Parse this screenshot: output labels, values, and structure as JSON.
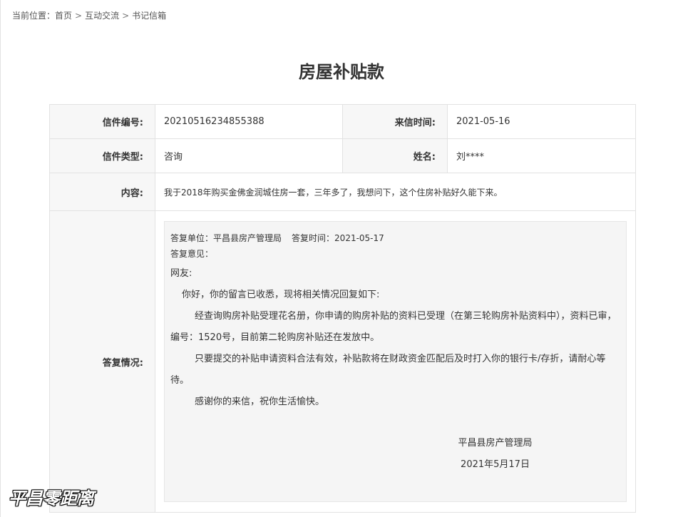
{
  "breadcrumb": {
    "prefix": "当前位置：",
    "items": [
      "首页",
      "互动交流",
      "书记信箱"
    ],
    "separator": ">"
  },
  "page_title": "房屋补贴款",
  "letter": {
    "number_label": "信件编号:",
    "number": "20210516234855388",
    "time_label": "来信时间:",
    "time": "2021-05-16",
    "type_label": "信件类型:",
    "type": "咨询",
    "name_label": "姓名:",
    "name": "刘****",
    "content_label": "内容:",
    "content": "我于2018年购买金佛金润城住房一套，三年多了，我想问下，这个住房补贴好久能下来。",
    "reply_label": "答复情况:"
  },
  "reply": {
    "unit_label": "答复单位：",
    "unit": "平昌县房产管理局",
    "time_label": "答复时间：",
    "time": "2021-05-17",
    "opinion_label": "答复意见：",
    "greeting": "网友:",
    "opening": "你好，你的留言已收悉，现将相关情况回复如下:",
    "para1_a": "经查询购房补贴受理花名册，你申请的购房补贴的资料已受理（在第三轮购房补贴资料中），资料已审，",
    "para1_b": "编号：1520号，目前第二轮购房补贴还在发放中。",
    "para2": "只要提交的补贴申请资料合法有效，补贴款将在财政资金匹配后及时打入你的银行卡/存折，请耐心等待。",
    "para3": "感谢你的来信，祝你生活愉快。",
    "sign_org": "平昌县房产管理局",
    "sign_date": "2021年5月17日"
  },
  "watermark": "平昌零距离"
}
